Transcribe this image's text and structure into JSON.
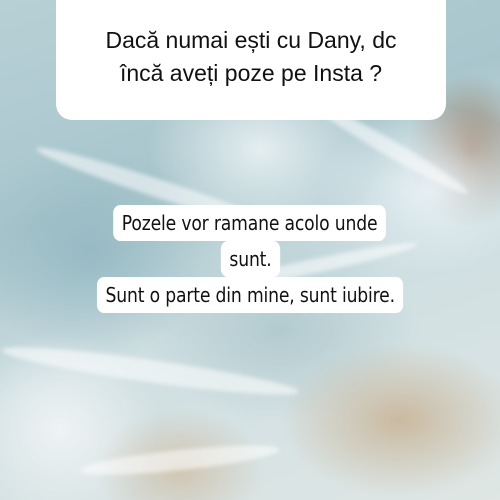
{
  "question": {
    "lines": [
      "Dacă numai ești cu Dany, dc",
      "încă aveți poze pe Insta ?"
    ]
  },
  "answer": {
    "lines": [
      "Pozele vor ramane acolo unde",
      "sunt.",
      "Sunt o parte din mine, sunt iubire."
    ]
  },
  "colors": {
    "card": "#ffffff",
    "text": "#111111",
    "background_main": "#b7d0d6",
    "background_accent": "#c8b294"
  }
}
